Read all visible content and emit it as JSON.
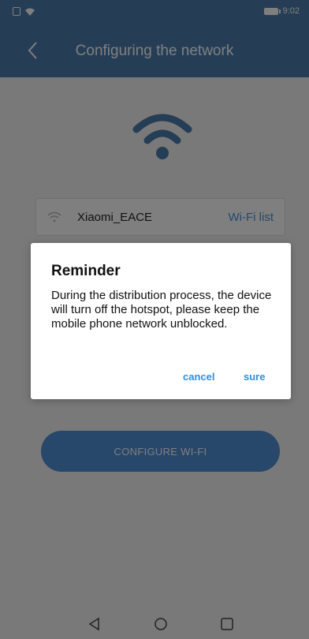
{
  "status_bar": {
    "time": "9:02"
  },
  "app_bar": {
    "title": "Configuring the network",
    "back_icon": "chevron-left-icon"
  },
  "wifi": {
    "ssid": "Xiaomi_EACE",
    "list_link": "Wi-Fi list"
  },
  "configure_button": {
    "label": "CONFIGURE WI-FI"
  },
  "dialog": {
    "title": "Reminder",
    "message": "During the distribution process, the device will turn off the hotspot, please keep the mobile phone network unblocked.",
    "cancel_label": "cancel",
    "confirm_label": "sure"
  },
  "colors": {
    "primary": "#4a7dac",
    "button": "#4f8ed7",
    "link": "#2f8ee0"
  },
  "nav_icons": [
    "back-triangle-icon",
    "home-circle-icon",
    "recents-square-icon"
  ]
}
